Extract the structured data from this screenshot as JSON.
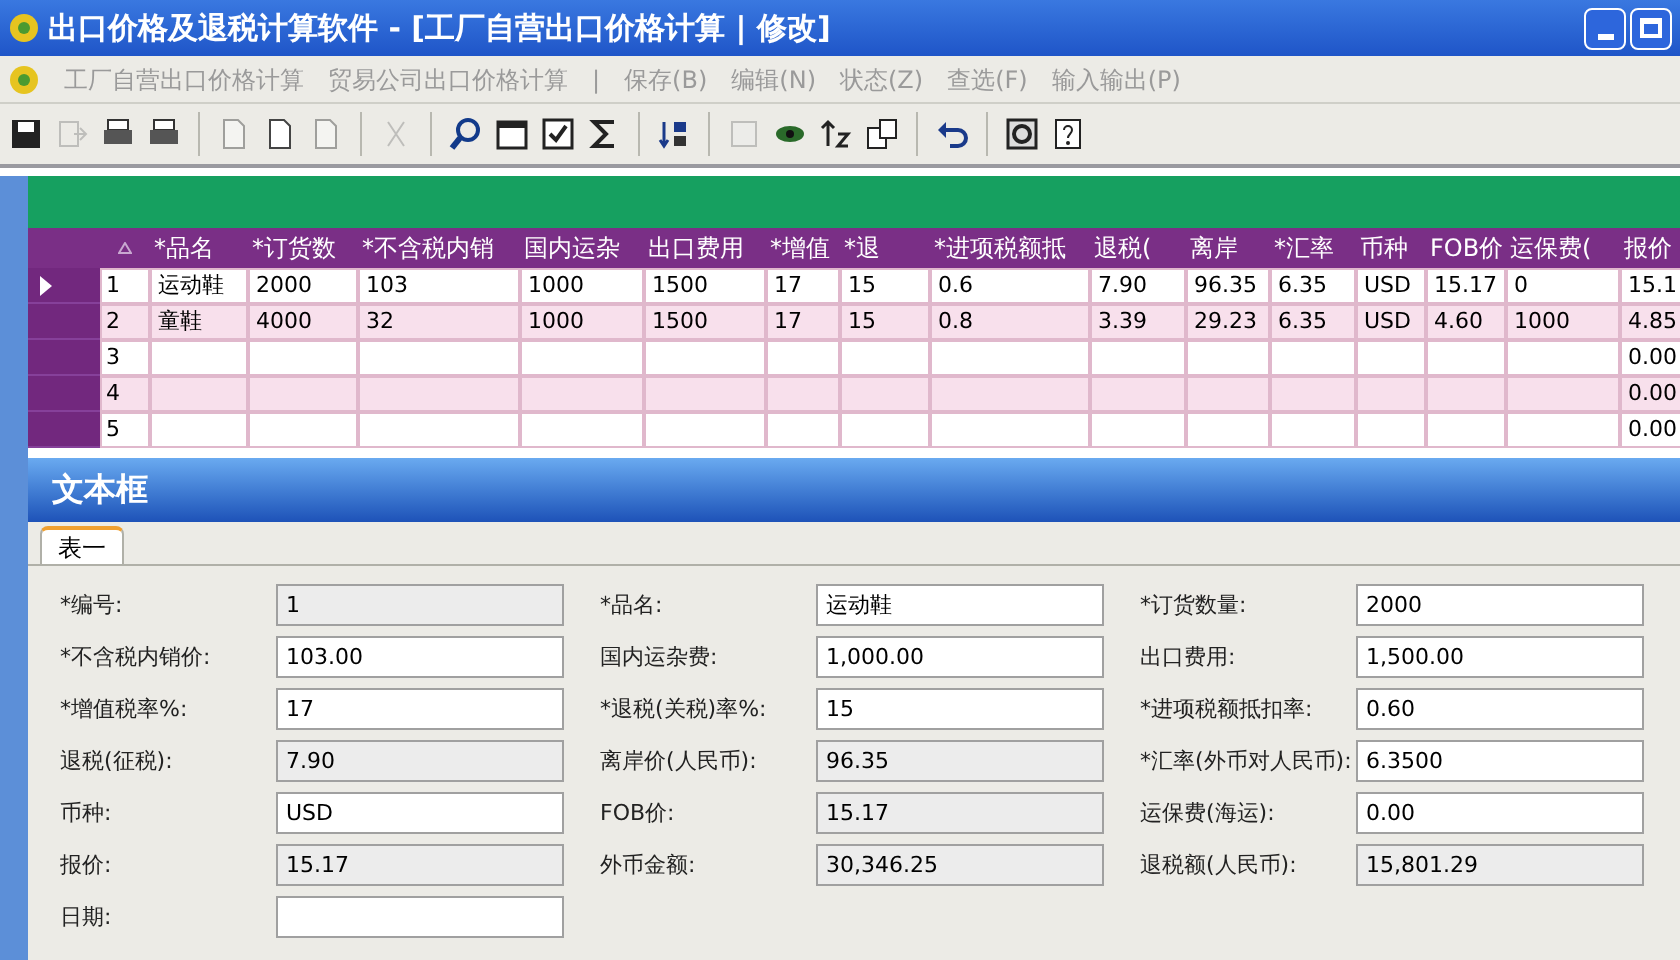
{
  "window": {
    "title": "出口价格及退税计算软件 - [工厂自营出口价格计算 | 修改]"
  },
  "menu": [
    {
      "label": "工厂自营出口价格计算"
    },
    {
      "label": "贸易公司出口价格计算"
    },
    {
      "label": "|"
    },
    {
      "label": "保存(B)"
    },
    {
      "label": "编辑(N)"
    },
    {
      "label": "状态(Z)"
    },
    {
      "label": "查选(F)"
    },
    {
      "label": "输入输出(P)"
    }
  ],
  "toolbar": [
    {
      "kind": "save",
      "disabled": false
    },
    {
      "kind": "export",
      "disabled": true
    },
    {
      "kind": "print",
      "disabled": false
    },
    {
      "kind": "print",
      "disabled": false
    },
    {
      "kind": "sep"
    },
    {
      "kind": "page",
      "disabled": true
    },
    {
      "kind": "page",
      "disabled": false
    },
    {
      "kind": "page",
      "disabled": true
    },
    {
      "kind": "sep"
    },
    {
      "kind": "cut",
      "disabled": true
    },
    {
      "kind": "sep"
    },
    {
      "kind": "search",
      "disabled": false
    },
    {
      "kind": "window",
      "disabled": false
    },
    {
      "kind": "check",
      "disabled": false
    },
    {
      "kind": "sigma",
      "disabled": false
    },
    {
      "kind": "sep"
    },
    {
      "kind": "sort",
      "disabled": false
    },
    {
      "kind": "sep"
    },
    {
      "kind": "doc",
      "disabled": true
    },
    {
      "kind": "eye",
      "disabled": false
    },
    {
      "kind": "updown",
      "disabled": false
    },
    {
      "kind": "copy",
      "disabled": false
    },
    {
      "kind": "sep"
    },
    {
      "kind": "undo",
      "disabled": false
    },
    {
      "kind": "sep"
    },
    {
      "kind": "stop",
      "disabled": false
    },
    {
      "kind": "help",
      "disabled": false
    }
  ],
  "table": {
    "columns": [
      "*品名",
      "*订货数",
      "*不含税内销",
      "国内运杂",
      "出口费用",
      "*增值",
      "*退",
      "*进项税额抵",
      "退税(",
      "离岸",
      "*汇率",
      "币种",
      "FOB价",
      "运保费(",
      "报价"
    ],
    "rows": [
      {
        "index": "1",
        "selected": true,
        "cells": [
          "运动鞋",
          "2000",
          "103",
          "1000",
          "1500",
          "17",
          "15",
          "0.6",
          "7.90",
          "96.35",
          "6.35",
          "USD",
          "15.17",
          "0",
          "15.1"
        ]
      },
      {
        "index": "2",
        "selected": false,
        "cells": [
          "童鞋",
          "4000",
          "32",
          "1000",
          "1500",
          "17",
          "15",
          "0.8",
          "3.39",
          "29.23",
          "6.35",
          "USD",
          "4.60",
          "1000",
          "4.85"
        ]
      },
      {
        "index": "3",
        "selected": false,
        "cells": [
          "",
          "",
          "",
          "",
          "",
          "",
          "",
          "",
          "",
          "",
          "",
          "",
          "",
          "",
          "0.00"
        ]
      },
      {
        "index": "4",
        "selected": false,
        "cells": [
          "",
          "",
          "",
          "",
          "",
          "",
          "",
          "",
          "",
          "",
          "",
          "",
          "",
          "",
          "0.00"
        ]
      },
      {
        "index": "5",
        "selected": false,
        "cells": [
          "",
          "",
          "",
          "",
          "",
          "",
          "",
          "",
          "",
          "",
          "",
          "",
          "",
          "",
          "0.00"
        ]
      }
    ]
  },
  "dialog": {
    "title": "文本框",
    "tabs": [
      {
        "label": "表一",
        "selected": true
      }
    ],
    "fields": [
      {
        "label": "*编号:",
        "value": "1",
        "readonly": true
      },
      {
        "label": "*品名:",
        "value": "运动鞋",
        "readonly": false
      },
      {
        "label": "*订货数量:",
        "value": "2000",
        "readonly": false
      },
      {
        "label": "*不含税内销价:",
        "value": "103.00",
        "readonly": false
      },
      {
        "label": "国内运杂费:",
        "value": "1,000.00",
        "readonly": false
      },
      {
        "label": "出口费用:",
        "value": "1,500.00",
        "readonly": false
      },
      {
        "label": "*增值税率%:",
        "value": "17",
        "readonly": false
      },
      {
        "label": "*退税(关税)率%:",
        "value": "15",
        "readonly": false
      },
      {
        "label": "*进项税额抵扣率:",
        "value": "0.60",
        "readonly": false
      },
      {
        "label": "退税(征税):",
        "value": "7.90",
        "readonly": true
      },
      {
        "label": "离岸价(人民币):",
        "value": "96.35",
        "readonly": true
      },
      {
        "label": "*汇率(外币对人民币):",
        "value": "6.3500",
        "readonly": false
      },
      {
        "label": "币种:",
        "value": "USD",
        "readonly": false
      },
      {
        "label": "FOB价:",
        "value": "15.17",
        "readonly": true
      },
      {
        "label": "运保费(海运):",
        "value": "0.00",
        "readonly": false
      },
      {
        "label": "报价:",
        "value": "15.17",
        "readonly": true
      },
      {
        "label": "外币金额:",
        "value": "30,346.25",
        "readonly": true
      },
      {
        "label": "退税额(人民币):",
        "value": "15,801.29",
        "readonly": true
      },
      {
        "label": "日期:",
        "readonly": false
      }
    ]
  }
}
